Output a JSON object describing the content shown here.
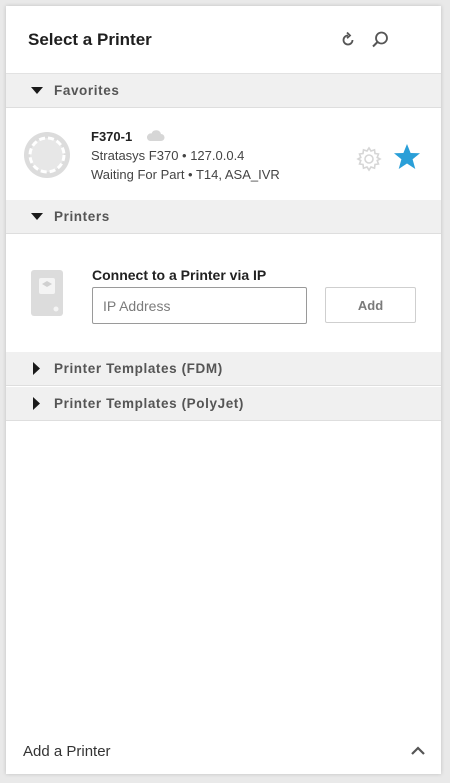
{
  "header": {
    "title": "Select a Printer",
    "refresh_icon": "refresh-icon",
    "search_icon": "search-icon"
  },
  "sections": {
    "favorites": {
      "label": "Favorites",
      "expanded": true
    },
    "printers": {
      "label": "Printers",
      "expanded": true
    },
    "templates_fdm": {
      "label": "Printer Templates (FDM)",
      "expanded": false
    },
    "templates_polyjet": {
      "label": "Printer Templates (PolyJet)",
      "expanded": false
    }
  },
  "favorite_printer": {
    "name": "F370-1",
    "model_ip": "Stratasys F370 • 127.0.0.4",
    "status": "Waiting For Part • T14, ASA_IVR",
    "favorited": true
  },
  "connect": {
    "title": "Connect to a Printer via IP",
    "ip_placeholder": "IP Address",
    "ip_value": "",
    "add_label": "Add"
  },
  "footer": {
    "label": "Add a Printer"
  },
  "colors": {
    "accent_star": "#2a9fd8",
    "section_bg": "#f0f0f0",
    "icon_gray": "#d0d0d0"
  }
}
